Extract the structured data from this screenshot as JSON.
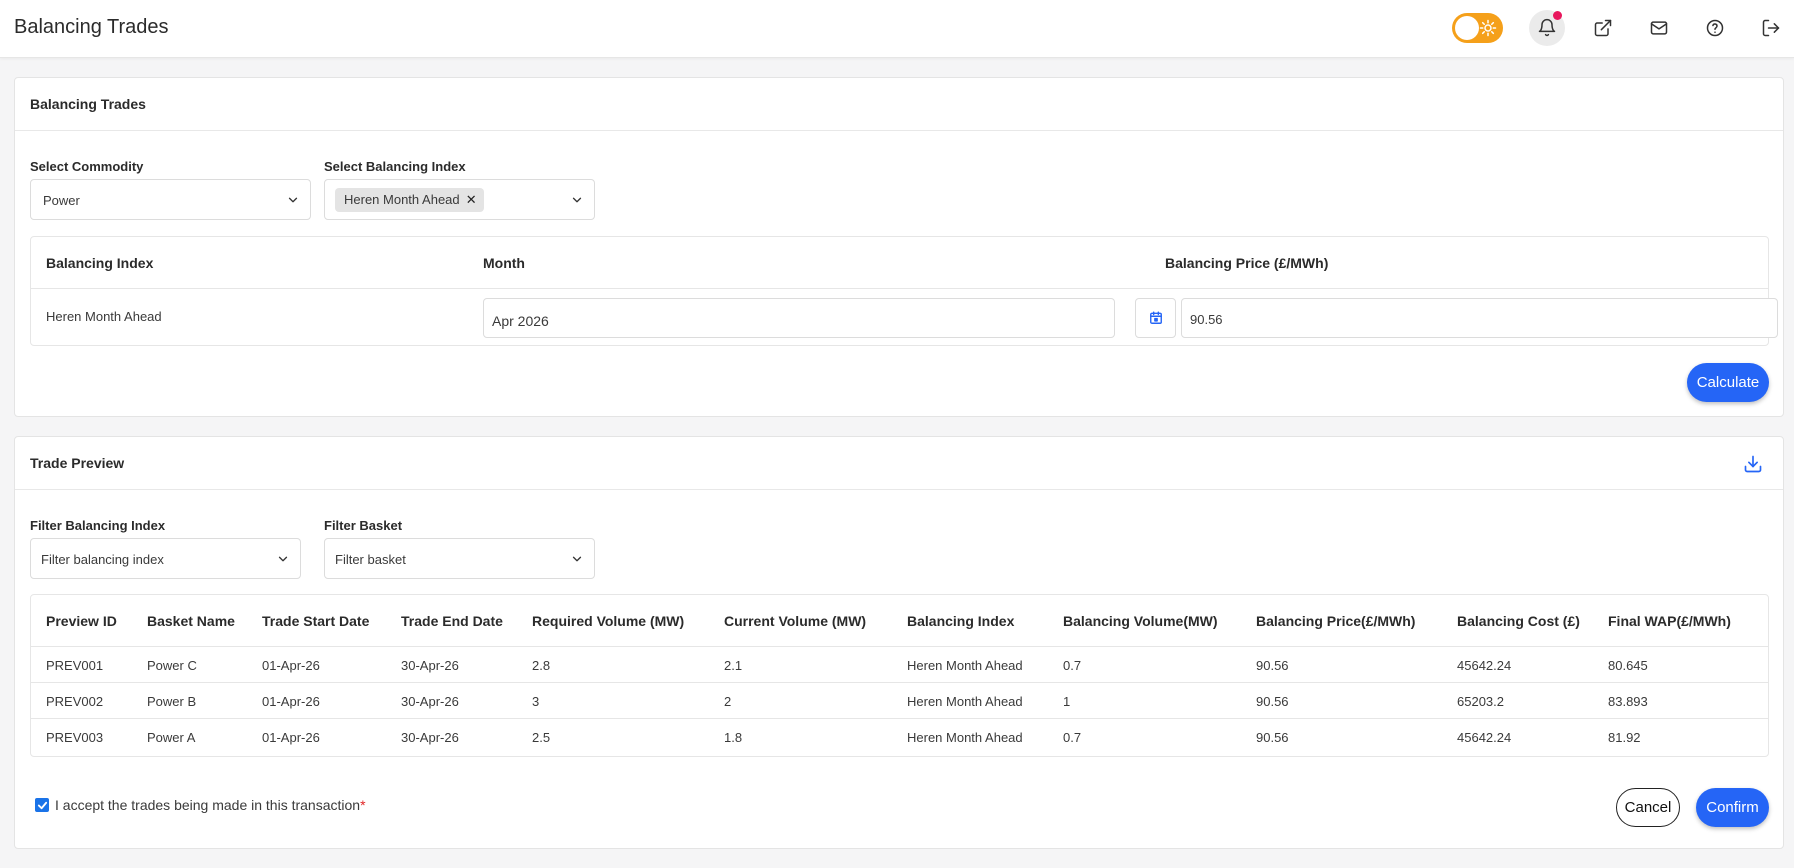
{
  "header": {
    "title": "Balancing Trades"
  },
  "balancing_card": {
    "title": "Balancing Trades",
    "commodity_label": "Select Commodity",
    "commodity_value": "Power",
    "index_label": "Select Balancing Index",
    "index_chip": "Heren Month Ahead",
    "table": {
      "col_index": "Balancing Index",
      "col_month": "Month",
      "col_price": "Balancing Price (£/MWh)",
      "row_index": "Heren Month Ahead",
      "row_month": "Apr 2026",
      "row_price": "90.56"
    },
    "calculate_label": "Calculate"
  },
  "preview_card": {
    "title": "Trade Preview",
    "filter_index_label": "Filter Balancing Index",
    "filter_index_placeholder": "Filter balancing index",
    "filter_basket_label": "Filter Basket",
    "filter_basket_placeholder": "Filter basket",
    "columns": [
      "Preview ID",
      "Basket Name",
      "Trade Start Date",
      "Trade End Date",
      "Required Volume (MW)",
      "Current Volume (MW)",
      "Balancing Index",
      "Balancing Volume(MW)",
      "Balancing Price(£/MWh)",
      "Balancing Cost (£)",
      "Final WAP(£/MWh)"
    ],
    "rows": [
      [
        "PREV001",
        "Power C",
        "01-Apr-26",
        "30-Apr-26",
        "2.8",
        "2.1",
        "Heren Month Ahead",
        "0.7",
        "90.56",
        "45642.24",
        "80.645"
      ],
      [
        "PREV002",
        "Power B",
        "01-Apr-26",
        "30-Apr-26",
        "3",
        "2",
        "Heren Month Ahead",
        "1",
        "90.56",
        "65203.2",
        "83.893"
      ],
      [
        "PREV003",
        "Power A",
        "01-Apr-26",
        "30-Apr-26",
        "2.5",
        "1.8",
        "Heren Month Ahead",
        "0.7",
        "90.56",
        "45642.24",
        "81.92"
      ]
    ],
    "accept_text": "I accept the trades being made in this transaction",
    "required_mark": "*",
    "cancel_label": "Cancel",
    "confirm_label": "Confirm"
  },
  "colors": {
    "primary": "#2565f6",
    "toggle": "#f5a01a",
    "notification_dot": "#e8175d"
  }
}
